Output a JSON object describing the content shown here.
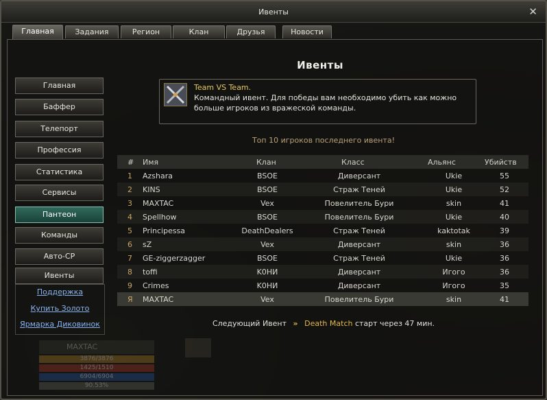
{
  "window": {
    "title": "Ивенты"
  },
  "tabs": [
    {
      "label": "Главная"
    },
    {
      "label": "Задания"
    },
    {
      "label": "Регион"
    },
    {
      "label": "Клан"
    },
    {
      "label": "Друзья"
    },
    {
      "label": "Новости"
    }
  ],
  "sidebar": {
    "items": [
      {
        "label": "Главная"
      },
      {
        "label": "Баффер"
      },
      {
        "label": "Телепорт"
      },
      {
        "label": "Профессия"
      },
      {
        "label": "Статистика"
      },
      {
        "label": "Сервисы"
      },
      {
        "label": "Пантеон"
      },
      {
        "label": "Команды"
      },
      {
        "label": "Авто-CP"
      },
      {
        "label": "Ивенты"
      }
    ],
    "links": [
      {
        "label": "Поддержка"
      },
      {
        "label": "Купить Золото"
      },
      {
        "label": "Ярмарка Диковинок"
      }
    ]
  },
  "main": {
    "heading": "Ивенты",
    "event": {
      "title": "Team VS Team.",
      "description": " Командный ивент. Для победы вам необходимо убить как можно больше игроков из вражеской команды."
    },
    "top10_caption": "Топ 10 игроков последнего ивента!",
    "table": {
      "headers": [
        "#",
        "Имя",
        "Клан",
        "Класс",
        "Альянс",
        "Убийств"
      ],
      "rows": [
        [
          "1",
          "Azshara",
          "BSOE",
          "Диверсант",
          "Ukie",
          "55"
        ],
        [
          "2",
          "KINS",
          "BSOE",
          "Страж Теней",
          "Ukie",
          "52"
        ],
        [
          "3",
          "MAXTAC",
          "Vex",
          "Повелитель Бури",
          "skin",
          "41"
        ],
        [
          "4",
          "Spellhow",
          "BSOE",
          "Повелитель Бури",
          "Ukie",
          "40"
        ],
        [
          "5",
          "Principessa",
          "DeathDealers",
          "Страж Теней",
          "kaktotak",
          "39"
        ],
        [
          "6",
          "sZ",
          "Vex",
          "Диверсант",
          "skin",
          "36"
        ],
        [
          "7",
          "GE-ziggerzagger",
          "BSOE",
          "Страж Теней",
          "Ukie",
          "36"
        ],
        [
          "8",
          "toffi",
          "K0HИ",
          "Диверсант",
          "Игого",
          "36"
        ],
        [
          "9",
          "Crimes",
          "K0HИ",
          "Диверсант",
          "Игого",
          "35"
        ],
        [
          "Я",
          "MAXTAC",
          "Vex",
          "Повелитель Бури",
          "skin",
          "41"
        ]
      ]
    },
    "next_event": {
      "prefix": "Следующий Ивент",
      "chevron": "»",
      "name": "Death Match",
      "suffix": "старт через 47 мин."
    }
  },
  "hud": {
    "name": "MAXTAC",
    "hp": "3876/3876",
    "mp": "1425/1510",
    "cp": "6904/6904",
    "exp": "90.53%"
  },
  "colors": {
    "accent_gold": "#e6b848",
    "link": "#8ab4f0",
    "active_button": "#2f6a5c"
  }
}
